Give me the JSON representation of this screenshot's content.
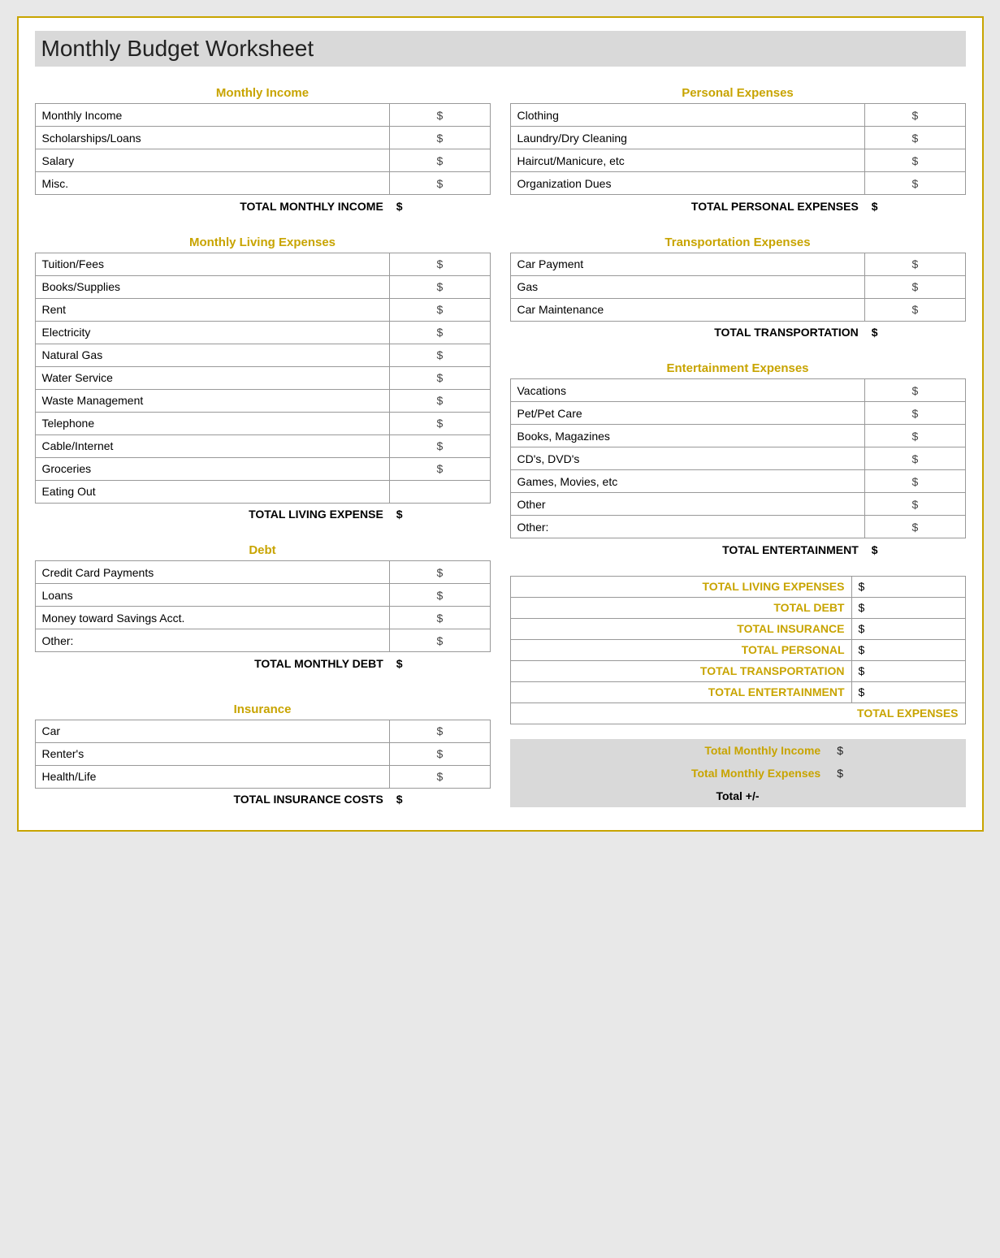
{
  "title": "Monthly Budget Worksheet",
  "left": {
    "monthly_income": {
      "section_title": "Monthly Income",
      "rows": [
        {
          "label": "Monthly Income",
          "dollar": "$"
        },
        {
          "label": "Scholarships/Loans",
          "dollar": "$"
        },
        {
          "label": "Salary",
          "dollar": "$"
        },
        {
          "label": "Misc.",
          "dollar": "$"
        }
      ],
      "total_label": "TOTAL MONTHLY INCOME",
      "total_dollar": "$"
    },
    "living_expenses": {
      "section_title": "Monthly Living Expenses",
      "rows": [
        {
          "label": "Tuition/Fees",
          "dollar": "$"
        },
        {
          "label": "Books/Supplies",
          "dollar": "$"
        },
        {
          "label": "Rent",
          "dollar": "$"
        },
        {
          "label": "Electricity",
          "dollar": "$"
        },
        {
          "label": "Natural Gas",
          "dollar": "$"
        },
        {
          "label": "Water Service",
          "dollar": "$"
        },
        {
          "label": "Waste Management",
          "dollar": "$"
        },
        {
          "label": "Telephone",
          "dollar": "$"
        },
        {
          "label": "Cable/Internet",
          "dollar": "$"
        },
        {
          "label": "Groceries",
          "dollar": "$"
        },
        {
          "label": "Eating Out",
          "dollar": ""
        }
      ],
      "total_label": "TOTAL LIVING EXPENSE",
      "total_dollar": "$"
    },
    "debt": {
      "section_title": "Debt",
      "rows": [
        {
          "label": "Credit Card Payments",
          "dollar": "$"
        },
        {
          "label": "Loans",
          "dollar": "$"
        },
        {
          "label": "Money toward Savings Acct.",
          "dollar": "$"
        },
        {
          "label": "Other:",
          "dollar": "$"
        }
      ],
      "total_label": "TOTAL MONTHLY DEBT",
      "total_dollar": "$"
    },
    "insurance": {
      "section_title": "Insurance",
      "rows": [
        {
          "label": "Car",
          "dollar": "$"
        },
        {
          "label": "Renter's",
          "dollar": "$"
        },
        {
          "label": "Health/Life",
          "dollar": "$"
        }
      ],
      "total_label": "TOTAL INSURANCE COSTS",
      "total_dollar": "$"
    }
  },
  "right": {
    "personal_expenses": {
      "section_title": "Personal Expenses",
      "rows": [
        {
          "label": "Clothing",
          "dollar": "$"
        },
        {
          "label": "Laundry/Dry Cleaning",
          "dollar": "$"
        },
        {
          "label": "Haircut/Manicure, etc",
          "dollar": "$"
        },
        {
          "label": "Organization Dues",
          "dollar": "$"
        }
      ],
      "total_label": "TOTAL PERSONAL EXPENSES",
      "total_dollar": "$"
    },
    "transportation": {
      "section_title": "Transportation Expenses",
      "rows": [
        {
          "label": "Car Payment",
          "dollar": "$"
        },
        {
          "label": "Gas",
          "dollar": "$"
        },
        {
          "label": "Car Maintenance",
          "dollar": "$"
        }
      ],
      "total_label": "TOTAL TRANSPORTATION",
      "total_dollar": "$"
    },
    "entertainment": {
      "section_title": "Entertainment Expenses",
      "rows": [
        {
          "label": "Vacations",
          "dollar": "$"
        },
        {
          "label": "Pet/Pet Care",
          "dollar": "$"
        },
        {
          "label": "Books, Magazines",
          "dollar": "$"
        },
        {
          "label": "CD's, DVD's",
          "dollar": "$"
        },
        {
          "label": "Games, Movies, etc",
          "dollar": "$"
        },
        {
          "label": "Other",
          "dollar": "$"
        },
        {
          "label": "Other:",
          "dollar": "$"
        }
      ],
      "total_label": "TOTAL ENTERTAINMENT",
      "total_dollar": "$"
    },
    "summary": {
      "rows": [
        {
          "label": "TOTAL LIVING EXPENSES",
          "dollar": "$"
        },
        {
          "label": "TOTAL DEBT",
          "dollar": "$"
        },
        {
          "label": "TOTAL INSURANCE",
          "dollar": "$"
        },
        {
          "label": "TOTAL PERSONAL",
          "dollar": "$"
        },
        {
          "label": "TOTAL TRANSPORTATION",
          "dollar": "$"
        },
        {
          "label": "TOTAL ENTERTAINMENT",
          "dollar": "$"
        }
      ],
      "total_expenses_label": "TOTAL EXPENSES",
      "total_expenses_dollar": ""
    },
    "bottom": {
      "total_income_label": "Total Monthly Income",
      "total_income_dollar": "$",
      "total_expenses_label": "Total Monthly Expenses",
      "total_expenses_dollar": "$",
      "total_plusminus_label": "Total +/-"
    }
  }
}
